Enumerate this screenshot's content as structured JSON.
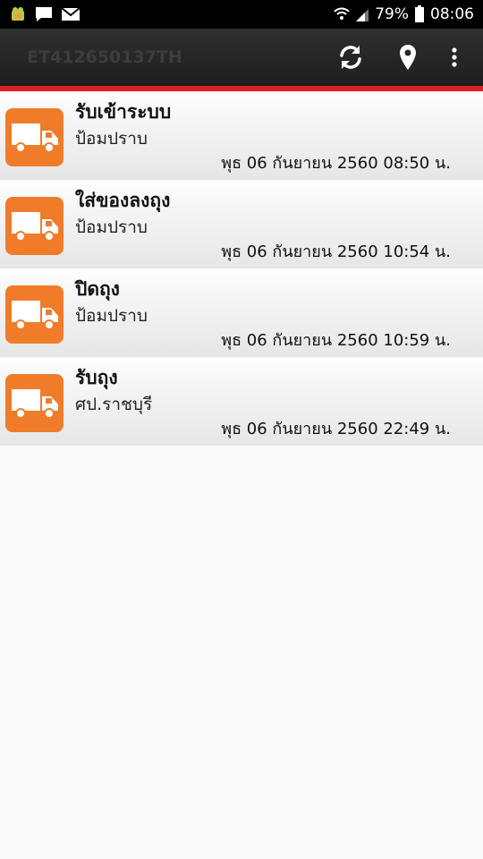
{
  "status_bar": {
    "battery_percent": "79%",
    "time": "08:06",
    "icons": [
      "android-debug-icon",
      "message-icon",
      "mail-icon",
      "wifi-icon",
      "signal-icon",
      "battery-icon"
    ]
  },
  "app_bar": {
    "title": "ET412650137TH",
    "actions": [
      "refresh-icon",
      "location-pin-icon",
      "overflow-menu-icon"
    ]
  },
  "colors": {
    "accent_red": "#e01e26",
    "thumb_orange": "#f07c2a",
    "app_bar": "#262626"
  },
  "items": [
    {
      "title": "รับเข้าระบบ",
      "place": "ป้อมปราบ",
      "time": "พุธ 06 กันยายน 2560 08:50 น.",
      "icon": "truck-icon"
    },
    {
      "title": "ใส่ของลงถุง",
      "place": "ป้อมปราบ",
      "time": "พุธ 06 กันยายน 2560 10:54 น.",
      "icon": "truck-icon"
    },
    {
      "title": "ปิดถุง",
      "place": "ป้อมปราบ",
      "time": "พุธ 06 กันยายน 2560 10:59 น.",
      "icon": "truck-icon"
    },
    {
      "title": "รับถุง",
      "place": "ศป.ราชบุรี",
      "time": "พุธ 06 กันยายน 2560 22:49 น.",
      "icon": "truck-icon"
    }
  ]
}
